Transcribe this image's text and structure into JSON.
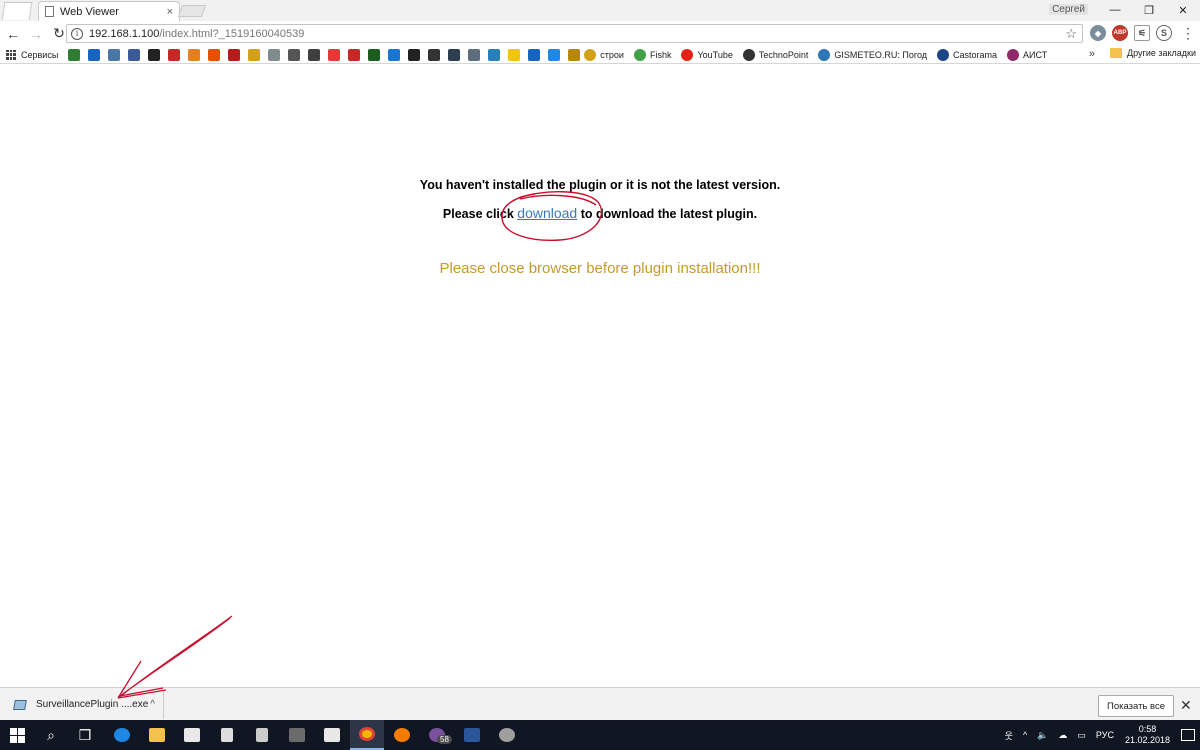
{
  "window": {
    "tab_title": "Web Viewer",
    "tab_close": "×",
    "profile_name": "Сергей",
    "min_glyph": "—",
    "max_glyph": "❐",
    "close_glyph": "✕"
  },
  "toolbar": {
    "back_glyph": "←",
    "forward_glyph": "→",
    "reload_glyph": "↻",
    "info_glyph": "i",
    "url_host": "192.168.1.100",
    "url_rest": "/index.html?_1519160040539",
    "star_glyph": "☆",
    "menu_glyph": "⋮",
    "ext_abp": "ABP",
    "ext_3": "⚟",
    "ext_4": "S",
    "ext_1": "◆"
  },
  "bookmarks": {
    "apps_label": "Сервисы",
    "icon_colors": [
      "#2e7d32",
      "#1565c0",
      "#4a76a8",
      "#3c5a99",
      "#222222",
      "#c62828",
      "#e67e22",
      "#e65100",
      "#b71c1c",
      "#d4a017",
      "#7f8c8d",
      "#555555",
      "#3f3f3f",
      "#e53935",
      "#c62828",
      "#1b5e20",
      "#1976d2",
      "#222222",
      "#333333",
      "#2c3e50",
      "#5d6d7e",
      "#2980b9",
      "#f1c40f",
      "#1565c0",
      "#1e88e5",
      "#b8860b"
    ],
    "items": [
      {
        "label": "строи",
        "color": "#d4a017"
      },
      {
        "label": "Fishk",
        "color": "#43a047"
      },
      {
        "label": "YouTube",
        "color": "#e62117"
      },
      {
        "label": "TechnoPoint",
        "color": "#333333"
      },
      {
        "label": "GISMETEO.RU: Погод",
        "color": "#2e75b6"
      },
      {
        "label": "Castorama",
        "color": "#1c4587"
      },
      {
        "label": "АИСТ",
        "color": "#8e2a6a"
      }
    ],
    "more_glyph": "»",
    "other_label": "Другие закладки"
  },
  "page": {
    "line1": "You haven't installed the plugin or it is not the latest version.",
    "line2_before": "Please click ",
    "download_link": "download",
    "line2_after": " to download the latest plugin.",
    "line3": "Please close browser before plugin installation!!!"
  },
  "download_shelf": {
    "file_name": "SurveillancePlugin ....exe",
    "chevron_glyph": "^",
    "show_all_label": "Показать все",
    "close_glyph": "✕"
  },
  "taskbar": {
    "search_glyph": "⌕",
    "taskview_glyph": "❒",
    "viber_badge": "58",
    "tray": {
      "person_glyph": "웃",
      "chevron_glyph": "^",
      "volume_glyph": "🔈",
      "network_glyph": "☁",
      "battery_glyph": "▭",
      "language": "РУС",
      "time": "0:58",
      "date": "21.02.2018"
    }
  }
}
